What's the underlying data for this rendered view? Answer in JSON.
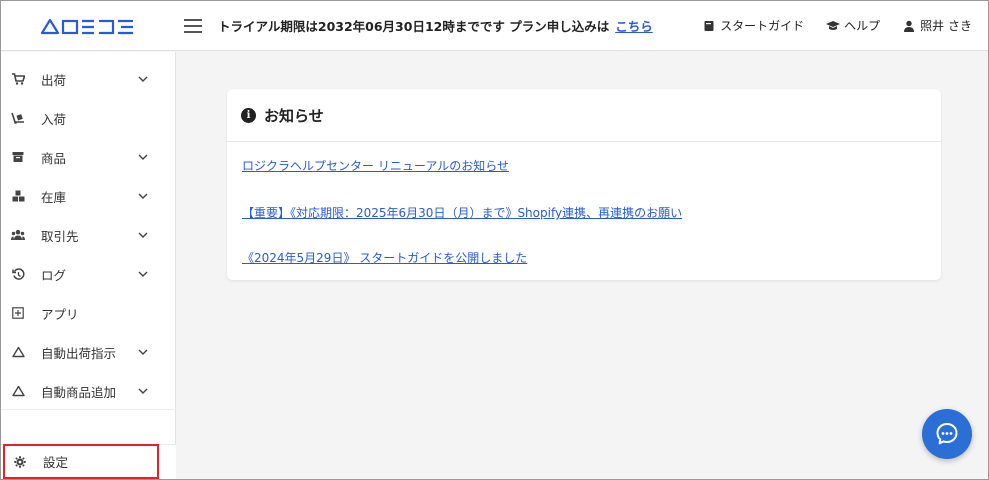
{
  "header": {
    "logo": "ОロジクラО",
    "logo_text": "ロジクラ",
    "trial_text": "トライアル期限は2032年06月30日12時までです プラン申し込みは",
    "trial_link": "こちら",
    "guide": "スタートガイド",
    "help": "ヘルプ",
    "user": "照井 さき"
  },
  "sidebar": {
    "items": [
      {
        "label": "出荷",
        "icon": "cart-icon",
        "chevron": true
      },
      {
        "label": "入荷",
        "icon": "dolly-icon",
        "chevron": false
      },
      {
        "label": "商品",
        "icon": "archive-box-icon",
        "chevron": true
      },
      {
        "label": "在庫",
        "icon": "boxes-icon",
        "chevron": true
      },
      {
        "label": "取引先",
        "icon": "users-icon",
        "chevron": true
      },
      {
        "label": "ログ",
        "icon": "history-icon",
        "chevron": true
      },
      {
        "label": "アプリ",
        "icon": "plus-square-icon",
        "chevron": false
      },
      {
        "label": "自動出荷指示",
        "icon": "triangle-icon",
        "chevron": true
      },
      {
        "label": "自動商品追加",
        "icon": "triangle-icon",
        "chevron": true
      }
    ],
    "settings": "設定"
  },
  "notices": {
    "title": "お知らせ",
    "items": [
      "ロジクラヘルプセンター リニューアルのお知らせ",
      "【重要】《対応期限：2025年6月30日（月）まで》Shopify連携、再連携のお願い",
      "《2024年5月29日》 スタートガイドを公開しました"
    ]
  },
  "colors": {
    "brand": "#2a5bd7",
    "highlight": "#e0242e",
    "fab": "#2a6fd6"
  }
}
